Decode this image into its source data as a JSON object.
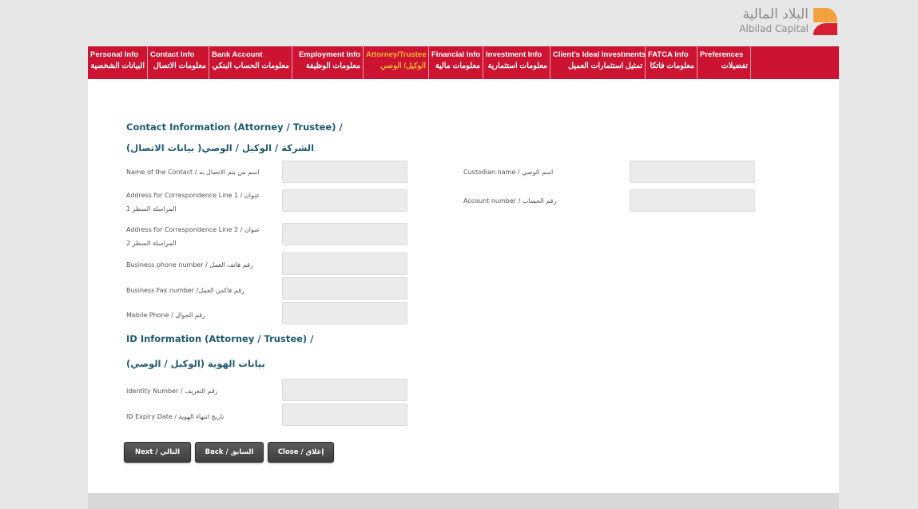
{
  "logo": {
    "arabic": "البلاد المالية",
    "english": "Albilad Capital"
  },
  "nav": [
    {
      "en": "Personal Info",
      "ar": "البيانات الشخصية",
      "active": false
    },
    {
      "en": "Contact Info",
      "ar": "معلومات الاتصال",
      "active": false
    },
    {
      "en": "Bank Account",
      "ar": "معلومات الحساب البنكي",
      "active": false
    },
    {
      "en": "Employment Info",
      "ar": "معلومات الوظيفة",
      "active": false
    },
    {
      "en": "Attorney/Trustee",
      "ar": "الوكيل/ الوصي",
      "active": true
    },
    {
      "en": "Financial Info",
      "ar": "معلومات مالية",
      "active": false
    },
    {
      "en": "Investment Info",
      "ar": "معلومات استثمارية",
      "active": false
    },
    {
      "en": "Client's Ideal Investments",
      "ar": "تمثيل استثمارات العميل",
      "active": false
    },
    {
      "en": "FATCA Info",
      "ar": "معلومات فاتكا",
      "active": false
    },
    {
      "en": "Preferences",
      "ar": "تفضيلات",
      "active": false
    }
  ],
  "contact_section": {
    "title_en": "Contact Information (Attorney / Trustee) /",
    "title_ar": "(بيانات الاتصال )الشركة / الوكيل / الوصي",
    "fields": {
      "contact_name": {
        "label": "Name of the Contact / اسم من يتم الاتصال به",
        "value": ""
      },
      "address1": {
        "label_line1": "Address for Correspondence Line 1 / عنوان",
        "label_line2": "المراسلة السطر 1",
        "value": ""
      },
      "address2": {
        "label_line1": "Address for Correspondence Line 2 / عنوان",
        "label_line2": "المراسلة السطر 2",
        "value": ""
      },
      "business_phone": {
        "label": "Business phone number / رقم هاتف العمل",
        "value": ""
      },
      "business_fax": {
        "label": "Business Fax number /رقم فاكس العمل",
        "value": ""
      },
      "mobile": {
        "label": "Mobile Phone / رقم الجوال",
        "value": ""
      },
      "custodian_name": {
        "label": "Custodian name / اسم الوصي",
        "value": ""
      },
      "account_number": {
        "label": "Account number / رقم الحساب",
        "value": ""
      }
    }
  },
  "id_section": {
    "title_en": "ID Information (Attorney / Trustee) /",
    "title_ar": "بيانات الهوية (الوكيل / الوصي)",
    "fields": {
      "identity_number": {
        "label": "Identity Number / رقم التعريف",
        "value": ""
      },
      "id_expiry": {
        "label": "ID Expiry Date / تاريخ انتهاء الهوية",
        "value": ""
      }
    }
  },
  "buttons": {
    "next": "Next / التالي",
    "back": "Back / السابق",
    "close": "Close / إغلاق"
  }
}
